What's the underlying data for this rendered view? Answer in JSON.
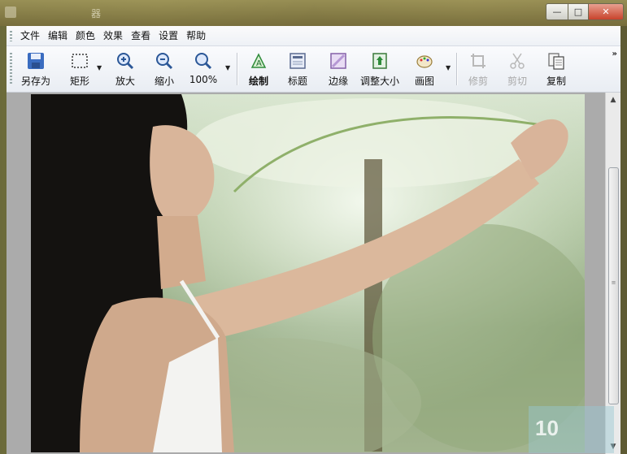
{
  "window": {
    "title": "器",
    "controls": {
      "minimize": "—",
      "maximize": "□",
      "close": "✕"
    }
  },
  "menubar": {
    "items": [
      {
        "label": "文件"
      },
      {
        "label": "编辑"
      },
      {
        "label": "颜色"
      },
      {
        "label": "效果"
      },
      {
        "label": "查看"
      },
      {
        "label": "设置"
      },
      {
        "label": "帮助"
      }
    ]
  },
  "toolbar": {
    "buttons": [
      {
        "label": "另存为",
        "icon": "save-icon"
      },
      {
        "label": "矩形",
        "icon": "rectangle-select-icon"
      },
      {
        "label": "放大",
        "icon": "zoom-in-icon"
      },
      {
        "label": "缩小",
        "icon": "zoom-out-icon"
      },
      {
        "label": "100%",
        "icon": "zoom-actual-icon"
      },
      {
        "label": "绘制",
        "icon": "draw-icon"
      },
      {
        "label": "标题",
        "icon": "caption-icon"
      },
      {
        "label": "边缘",
        "icon": "border-icon"
      },
      {
        "label": "调整大小",
        "icon": "resize-icon"
      },
      {
        "label": "画图",
        "icon": "paint-icon"
      },
      {
        "label": "修剪",
        "icon": "crop-icon"
      },
      {
        "label": "剪切",
        "icon": "cut-icon"
      },
      {
        "label": "复制",
        "icon": "copy-icon"
      }
    ],
    "more": "»"
  },
  "canvas": {
    "image_description_icon": "photo-image"
  },
  "watermark": {
    "text": "10"
  },
  "colors": {
    "accent": "#2b5797",
    "close": "#c8432c"
  }
}
